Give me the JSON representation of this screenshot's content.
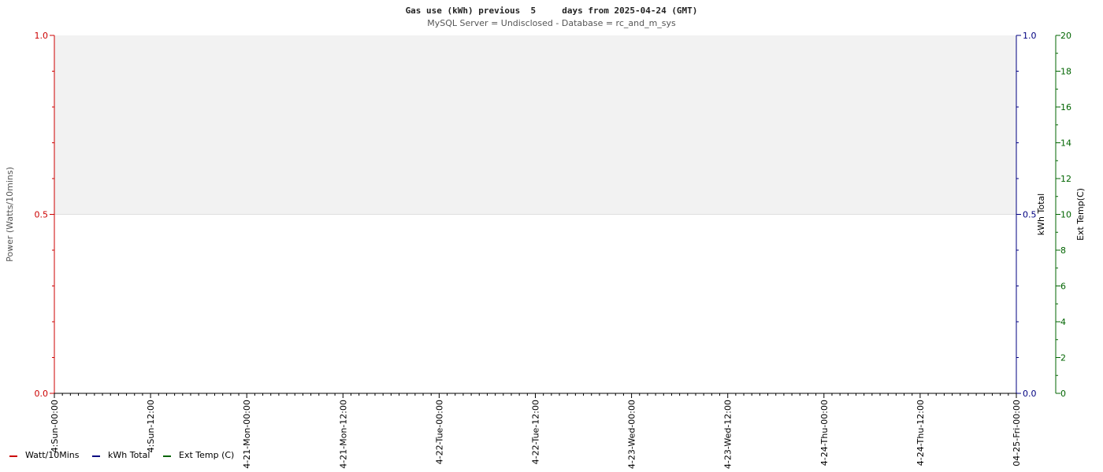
{
  "chart_data": {
    "type": "line",
    "title": "Gas use (kWh) previous  5     days from 2025-04-24 (GMT)",
    "subtitle": "MySQL Server = Undisclosed - Database = rc_and_m_sys",
    "left_axis": {
      "label": "Power (Watts/10mins)",
      "range": [
        0,
        1
      ],
      "ticks": [
        "0.0",
        "0.5",
        "1.0"
      ],
      "color": "#cc0000"
    },
    "right_axis_1": {
      "label": "kWh Total",
      "range": [
        0,
        1
      ],
      "ticks": [
        "0.0",
        "0.5",
        "1.0"
      ],
      "color": "#000080"
    },
    "right_axis_2": {
      "label": "Ext Temp(C)",
      "range": [
        0,
        20
      ],
      "ticks": [
        "0",
        "2",
        "4",
        "6",
        "8",
        "10",
        "12",
        "14",
        "16",
        "18",
        "20"
      ],
      "color": "#006400"
    },
    "x_tick_labels": [
      "4:Sun-00:00",
      "4:Sun-12:00",
      "4-21-Mon-00:00",
      "4-21-Mon-12:00",
      "4-22-Tue-00:00",
      "4-22-Tue-12:00",
      "4-23-Wed-00:00",
      "4-23-Wed-12:00",
      "4-24-Thu-00:00",
      "4-24-Thu-12:00",
      "04-25-Fri-00:00"
    ],
    "series": [
      {
        "name": "Watt/10Mins",
        "color": "#cc0000",
        "values": []
      },
      {
        "name": "kWh Total",
        "color": "#000080",
        "values": []
      },
      {
        "name": "Ext Temp (C)",
        "color": "#006400",
        "values": []
      }
    ],
    "grid": true,
    "legend_position": "bottom-left"
  }
}
